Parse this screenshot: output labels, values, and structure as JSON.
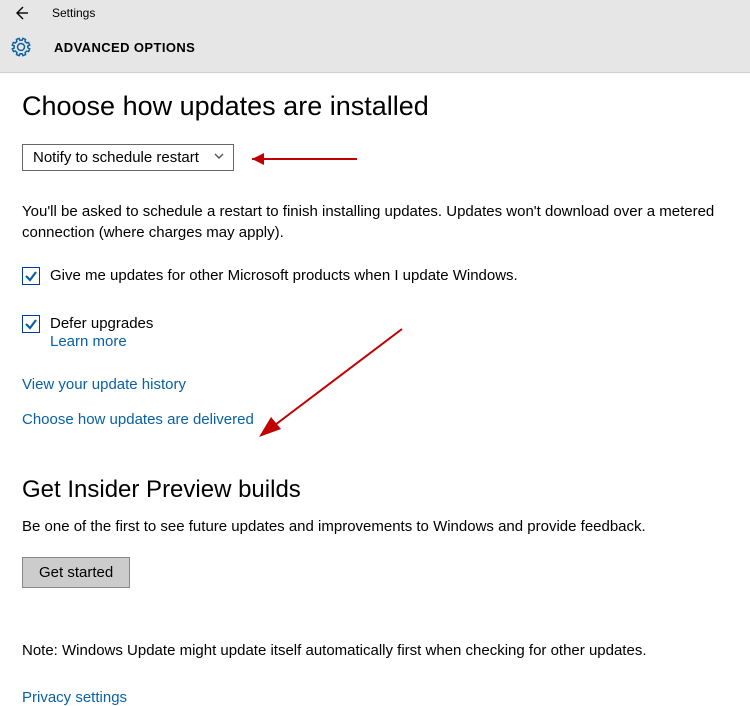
{
  "window": {
    "title": "Settings",
    "page": "ADVANCED OPTIONS"
  },
  "section_updates": {
    "heading": "Choose how updates are installed",
    "dropdown_value": "Notify to schedule restart",
    "description": "You'll be asked to schedule a restart to finish installing updates. Updates won't download over a metered connection (where charges may apply).",
    "checkbox_other_products": "Give me updates for other Microsoft products when I update Windows.",
    "checkbox_defer": "Defer upgrades",
    "learn_more": "Learn more",
    "link_history": "View your update history",
    "link_delivery": "Choose how updates are delivered"
  },
  "section_insider": {
    "heading": "Get Insider Preview builds",
    "description": "Be one of the first to see future updates and improvements to Windows and provide feedback.",
    "button": "Get started",
    "note": "Note: Windows Update might update itself automatically first when checking for other updates.",
    "privacy_link": "Privacy settings"
  }
}
